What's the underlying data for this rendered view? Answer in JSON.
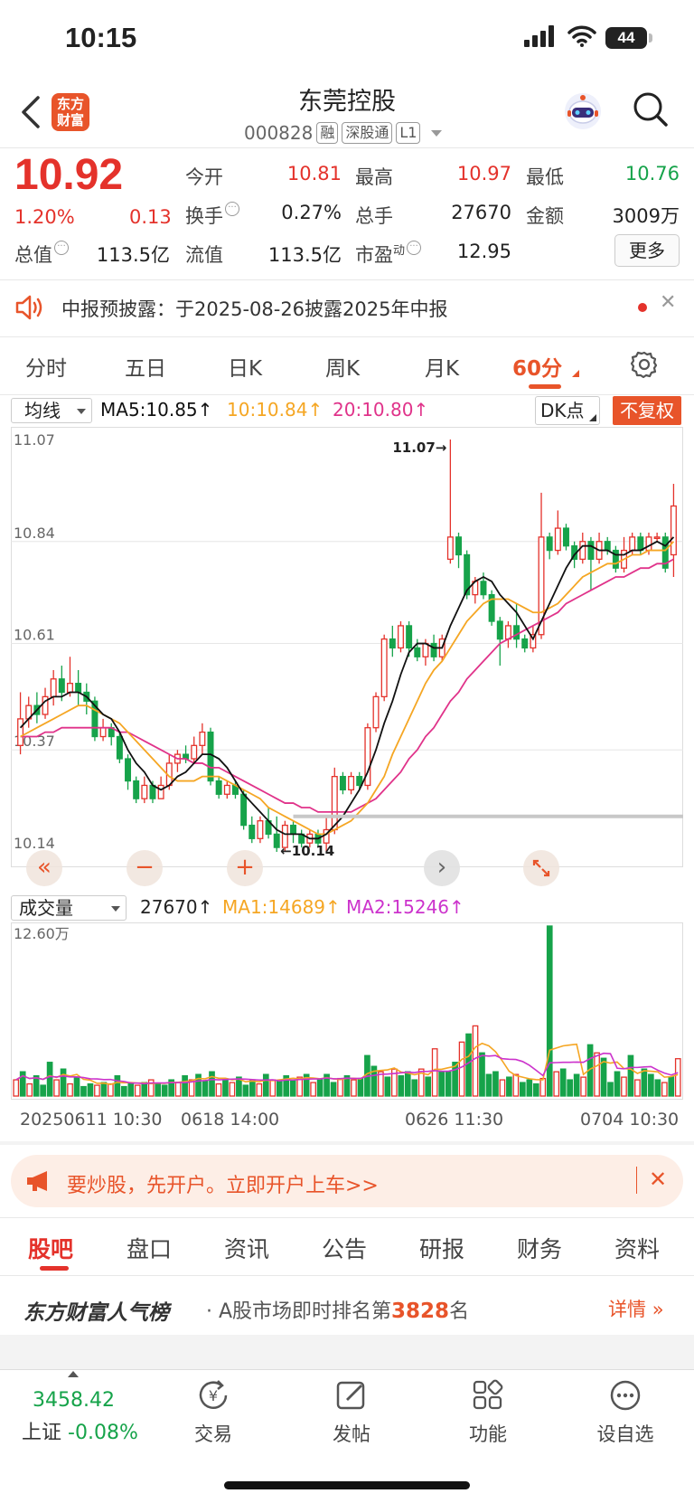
{
  "status_bar": {
    "time": "10:15",
    "battery": "44"
  },
  "header": {
    "logo_text_1": "东方",
    "logo_text_2": "财富",
    "stock_name": "东莞控股",
    "stock_code": "000828",
    "tags": [
      "融",
      "深股通",
      "L1"
    ]
  },
  "quote": {
    "price": "10.92",
    "change_pct": "1.20%",
    "change": "0.13",
    "fields": [
      {
        "label": "今开",
        "value": "10.81",
        "color": "#e4322b"
      },
      {
        "label": "最高",
        "value": "10.97",
        "color": "#e4322b"
      },
      {
        "label": "最低",
        "value": "10.76",
        "color": "#16a34a"
      },
      {
        "label": "换手",
        "value": "0.27%",
        "color": "#222222"
      },
      {
        "label": "总手",
        "value": "27670",
        "color": "#222222"
      },
      {
        "label": "金额",
        "value": "3009万",
        "color": "#222222"
      },
      {
        "label": "总值",
        "value": "113.5亿",
        "color": "#222222"
      },
      {
        "label": "流值",
        "value": "113.5亿",
        "color": "#222222"
      },
      {
        "label": "市盈",
        "label_sup": "动",
        "value": "12.95",
        "color": "#222222"
      }
    ],
    "more_label": "更多"
  },
  "notice": {
    "text": "中报预披露：于2025-08-26披露2025年中报"
  },
  "period_tabs": [
    "分时",
    "五日",
    "日K",
    "周K",
    "月K",
    "60分"
  ],
  "active_period": "60分",
  "ma_legend": {
    "select_label": "均线",
    "ma5": "MA5:10.85↑",
    "ma10": "10:10.84↑",
    "ma20": "20:10.80↑",
    "dk_label": "DK点",
    "fuquan_label": "不复权"
  },
  "chart_data": {
    "type": "candlestick",
    "y_ticks": [
      "11.07",
      "10.84",
      "10.61",
      "10.37",
      "10.14"
    ],
    "ylim": [
      10.14,
      11.07
    ],
    "max_label": "11.07",
    "min_label": "10.14",
    "series_colors": {
      "up": "#e4322b",
      "down": "#16a34a",
      "ma5": "#111111",
      "ma10": "#f5a623",
      "ma20": "#e0338a"
    },
    "candles": [
      [
        10.38,
        10.44,
        10.5,
        10.36
      ],
      [
        10.44,
        10.47,
        10.49,
        10.42
      ],
      [
        10.47,
        10.45,
        10.5,
        10.43
      ],
      [
        10.45,
        10.49,
        10.51,
        10.44
      ],
      [
        10.49,
        10.53,
        10.55,
        10.47
      ],
      [
        10.53,
        10.5,
        10.56,
        10.48
      ],
      [
        10.5,
        10.52,
        10.58,
        10.49
      ],
      [
        10.52,
        10.5,
        10.55,
        10.47
      ],
      [
        10.5,
        10.48,
        10.52,
        10.45
      ],
      [
        10.48,
        10.4,
        10.49,
        10.39
      ],
      [
        10.4,
        10.42,
        10.44,
        10.39
      ],
      [
        10.42,
        10.4,
        10.43,
        10.38
      ],
      [
        10.4,
        10.35,
        10.41,
        10.34
      ],
      [
        10.35,
        10.3,
        10.36,
        10.28
      ],
      [
        10.3,
        10.26,
        10.31,
        10.25
      ],
      [
        10.26,
        10.29,
        10.31,
        10.25
      ],
      [
        10.29,
        10.26,
        10.3,
        10.25
      ],
      [
        10.26,
        10.29,
        10.31,
        10.26
      ],
      [
        10.29,
        10.34,
        10.36,
        10.28
      ],
      [
        10.34,
        10.36,
        10.37,
        10.32
      ],
      [
        10.36,
        10.35,
        10.38,
        10.34
      ],
      [
        10.35,
        10.38,
        10.4,
        10.34
      ],
      [
        10.38,
        10.41,
        10.43,
        10.36
      ],
      [
        10.41,
        10.3,
        10.42,
        10.29
      ],
      [
        10.3,
        10.27,
        10.31,
        10.26
      ],
      [
        10.27,
        10.29,
        10.3,
        10.26
      ],
      [
        10.29,
        10.27,
        10.3,
        10.26
      ],
      [
        10.27,
        10.2,
        10.28,
        10.19
      ],
      [
        10.2,
        10.17,
        10.22,
        10.16
      ],
      [
        10.17,
        10.21,
        10.22,
        10.16
      ],
      [
        10.21,
        10.18,
        10.24,
        10.17
      ],
      [
        10.18,
        10.15,
        10.22,
        10.14
      ],
      [
        10.15,
        10.2,
        10.21,
        10.14
      ],
      [
        10.2,
        10.18,
        10.21,
        10.16
      ],
      [
        10.18,
        10.16,
        10.19,
        10.15
      ],
      [
        10.16,
        10.18,
        10.19,
        10.15
      ],
      [
        10.18,
        10.16,
        10.19,
        10.15
      ],
      [
        10.16,
        10.19,
        10.22,
        10.14
      ],
      [
        10.19,
        10.31,
        10.33,
        10.18
      ],
      [
        10.31,
        10.28,
        10.32,
        10.27
      ],
      [
        10.28,
        10.31,
        10.32,
        10.27
      ],
      [
        10.31,
        10.29,
        10.32,
        10.28
      ],
      [
        10.29,
        10.42,
        10.43,
        10.28
      ],
      [
        10.42,
        10.49,
        10.5,
        10.41
      ],
      [
        10.49,
        10.62,
        10.63,
        10.48
      ],
      [
        10.62,
        10.6,
        10.65,
        10.58
      ],
      [
        10.6,
        10.65,
        10.66,
        10.59
      ],
      [
        10.65,
        10.6,
        10.66,
        10.58
      ],
      [
        10.6,
        10.58,
        10.62,
        10.57
      ],
      [
        10.58,
        10.61,
        10.62,
        10.56
      ],
      [
        10.61,
        10.58,
        10.63,
        10.57
      ],
      [
        10.58,
        10.62,
        10.63,
        10.57
      ],
      [
        10.8,
        10.85,
        11.07,
        10.79
      ],
      [
        10.85,
        10.81,
        10.86,
        10.78
      ],
      [
        10.81,
        10.72,
        10.82,
        10.71
      ],
      [
        10.72,
        10.75,
        10.76,
        10.7
      ],
      [
        10.75,
        10.72,
        10.77,
        10.71
      ],
      [
        10.72,
        10.66,
        10.73,
        10.65
      ],
      [
        10.66,
        10.62,
        10.67,
        10.56
      ],
      [
        10.62,
        10.65,
        10.66,
        10.6
      ],
      [
        10.65,
        10.62,
        10.7,
        10.6
      ],
      [
        10.62,
        10.6,
        10.63,
        10.59
      ],
      [
        10.6,
        10.63,
        10.65,
        10.59
      ],
      [
        10.63,
        10.85,
        10.95,
        10.62
      ],
      [
        10.85,
        10.82,
        10.86,
        10.8
      ],
      [
        10.82,
        10.87,
        10.91,
        10.81
      ],
      [
        10.87,
        10.83,
        10.88,
        10.82
      ],
      [
        10.83,
        10.8,
        10.84,
        10.78
      ],
      [
        10.8,
        10.84,
        10.86,
        10.79
      ],
      [
        10.84,
        10.8,
        10.85,
        10.73
      ],
      [
        10.8,
        10.84,
        10.86,
        10.79
      ],
      [
        10.84,
        10.82,
        10.85,
        10.81
      ],
      [
        10.82,
        10.78,
        10.83,
        10.77
      ],
      [
        10.78,
        10.82,
        10.85,
        10.77
      ],
      [
        10.82,
        10.85,
        10.86,
        10.81
      ],
      [
        10.85,
        10.82,
        10.86,
        10.81
      ],
      [
        10.82,
        10.85,
        10.86,
        10.81
      ],
      [
        10.85,
        10.85,
        10.86,
        10.84
      ],
      [
        10.85,
        10.78,
        10.86,
        10.77
      ],
      [
        10.81,
        10.92,
        10.97,
        10.76
      ]
    ],
    "ma5": [
      10.42,
      10.44,
      10.46,
      10.48,
      10.49,
      10.49,
      10.5,
      10.5,
      10.49,
      10.47,
      10.45,
      10.44,
      10.41,
      10.37,
      10.34,
      10.32,
      10.29,
      10.28,
      10.29,
      10.31,
      10.32,
      10.34,
      10.36,
      10.36,
      10.35,
      10.33,
      10.3,
      10.27,
      10.25,
      10.23,
      10.21,
      10.19,
      10.18,
      10.18,
      10.18,
      10.17,
      10.17,
      10.18,
      10.2,
      10.22,
      10.25,
      10.28,
      10.32,
      10.37,
      10.43,
      10.48,
      10.54,
      10.59,
      10.61,
      10.61,
      10.6,
      10.6,
      10.65,
      10.69,
      10.73,
      10.75,
      10.76,
      10.75,
      10.72,
      10.7,
      10.68,
      10.65,
      10.62,
      10.66,
      10.7,
      10.74,
      10.78,
      10.81,
      10.83,
      10.83,
      10.82,
      10.82,
      10.81,
      10.81,
      10.82,
      10.82,
      10.83,
      10.84,
      10.83,
      10.85
    ],
    "ma10": [
      10.4,
      10.41,
      10.42,
      10.43,
      10.44,
      10.45,
      10.46,
      10.47,
      10.47,
      10.46,
      10.45,
      10.44,
      10.43,
      10.41,
      10.39,
      10.37,
      10.35,
      10.33,
      10.31,
      10.3,
      10.3,
      10.3,
      10.31,
      10.31,
      10.31,
      10.3,
      10.29,
      10.28,
      10.27,
      10.26,
      10.24,
      10.23,
      10.22,
      10.21,
      10.2,
      10.19,
      10.18,
      10.18,
      10.19,
      10.2,
      10.21,
      10.23,
      10.25,
      10.28,
      10.31,
      10.36,
      10.4,
      10.44,
      10.48,
      10.52,
      10.55,
      10.57,
      10.6,
      10.63,
      10.66,
      10.68,
      10.7,
      10.71,
      10.71,
      10.71,
      10.7,
      10.69,
      10.68,
      10.68,
      10.69,
      10.7,
      10.72,
      10.74,
      10.76,
      10.77,
      10.78,
      10.79,
      10.79,
      10.8,
      10.81,
      10.81,
      10.82,
      10.82,
      10.82,
      10.84
    ],
    "ma20": [
      10.4,
      10.4,
      10.4,
      10.41,
      10.41,
      10.42,
      10.42,
      10.42,
      10.42,
      10.42,
      10.42,
      10.42,
      10.41,
      10.41,
      10.4,
      10.39,
      10.38,
      10.37,
      10.36,
      10.35,
      10.35,
      10.34,
      10.34,
      10.33,
      10.33,
      10.32,
      10.31,
      10.3,
      10.29,
      10.28,
      10.27,
      10.26,
      10.25,
      10.25,
      10.24,
      10.24,
      10.23,
      10.23,
      10.23,
      10.23,
      10.23,
      10.24,
      10.25,
      10.26,
      10.28,
      10.3,
      10.32,
      10.35,
      10.37,
      10.4,
      10.42,
      10.45,
      10.48,
      10.5,
      10.53,
      10.55,
      10.57,
      10.59,
      10.61,
      10.62,
      10.63,
      10.64,
      10.65,
      10.66,
      10.67,
      10.68,
      10.7,
      10.71,
      10.72,
      10.73,
      10.74,
      10.75,
      10.76,
      10.76,
      10.77,
      10.78,
      10.78,
      10.79,
      10.79,
      10.8
    ]
  },
  "volume": {
    "select_label": "成交量",
    "current": "27670↑",
    "ma1": "MA1:14689↑",
    "ma2": "MA2:15246↑",
    "max_label": "12.60万",
    "ymax": 126000,
    "values": [
      12000,
      18000,
      9000,
      15000,
      8000,
      25000,
      12000,
      20000,
      9000,
      14000,
      7000,
      9000,
      8000,
      10000,
      9000,
      15000,
      7000,
      9000,
      8000,
      10000,
      12000,
      9000,
      8000,
      12000,
      10000,
      15000,
      12000,
      16000,
      11000,
      18000,
      9000,
      12000,
      10000,
      14000,
      8000,
      12000,
      9000,
      16000,
      12000,
      11000,
      15000,
      12000,
      14000,
      16000,
      10000,
      12000,
      16000,
      10000,
      13000,
      15000,
      12000,
      13000,
      30000,
      22000,
      18000,
      14000,
      20000,
      15000,
      18000,
      12000,
      20000,
      14000,
      35000,
      18000,
      18000,
      25000,
      40000,
      46000,
      52000,
      32000,
      16000,
      18000,
      12000,
      14000,
      16000,
      10000,
      12000,
      9000,
      13000,
      126000,
      18000,
      20000,
      12000,
      16000,
      14000,
      38000,
      32000,
      28000,
      10000,
      18000,
      14000,
      30000,
      12000,
      20000,
      16000,
      12000,
      10000,
      14000,
      27670
    ]
  },
  "date_labels": [
    "20250611 10:30",
    "0618 14:00",
    "0626 11:30",
    "0704 10:30"
  ],
  "ad": {
    "text": "要炒股，先开户。立即开户上车>>"
  },
  "bottom_tabs": [
    "股吧",
    "盘口",
    "资讯",
    "公告",
    "研报",
    "财务",
    "资料"
  ],
  "ranking": {
    "brand": "东方财富人气榜",
    "prefix": "·  A股市场即时排名第",
    "rank": "3828",
    "suffix": "名",
    "detail": "详情"
  },
  "index": {
    "value": "3458.42",
    "name": "上证",
    "change": "-0.08%"
  },
  "bottom_nav": [
    "交易",
    "发帖",
    "功能",
    "设自选"
  ]
}
